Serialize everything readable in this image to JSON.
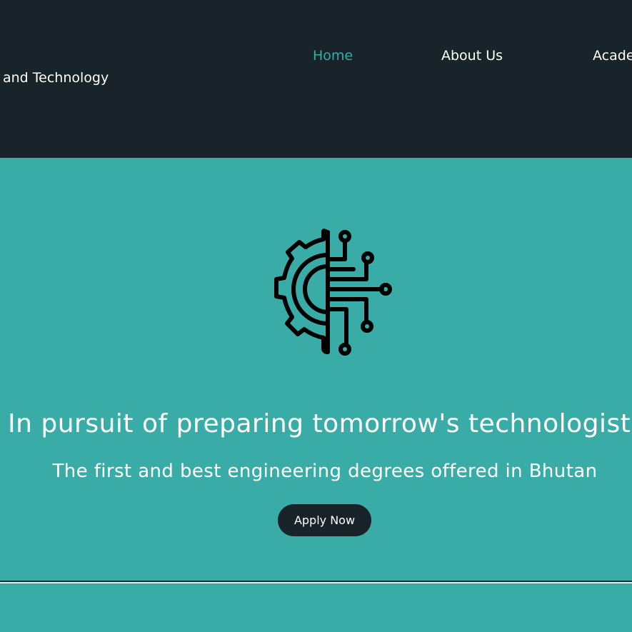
{
  "header": {
    "brand_text": "and Technology",
    "nav": {
      "home": "Home",
      "about": "About Us",
      "academics": "Academics"
    },
    "colors": {
      "background": "#18232a",
      "active": "#3aaca8",
      "text": "#ffffff"
    }
  },
  "hero": {
    "icon": "gear-circuit-icon",
    "headline": "In pursuit of preparing tomorrow's technologists",
    "subheadline": "The first and best engineering degrees offered in Bhutan",
    "cta_label": "Apply Now",
    "colors": {
      "background": "#3aaca8",
      "button": "#18232a"
    }
  }
}
